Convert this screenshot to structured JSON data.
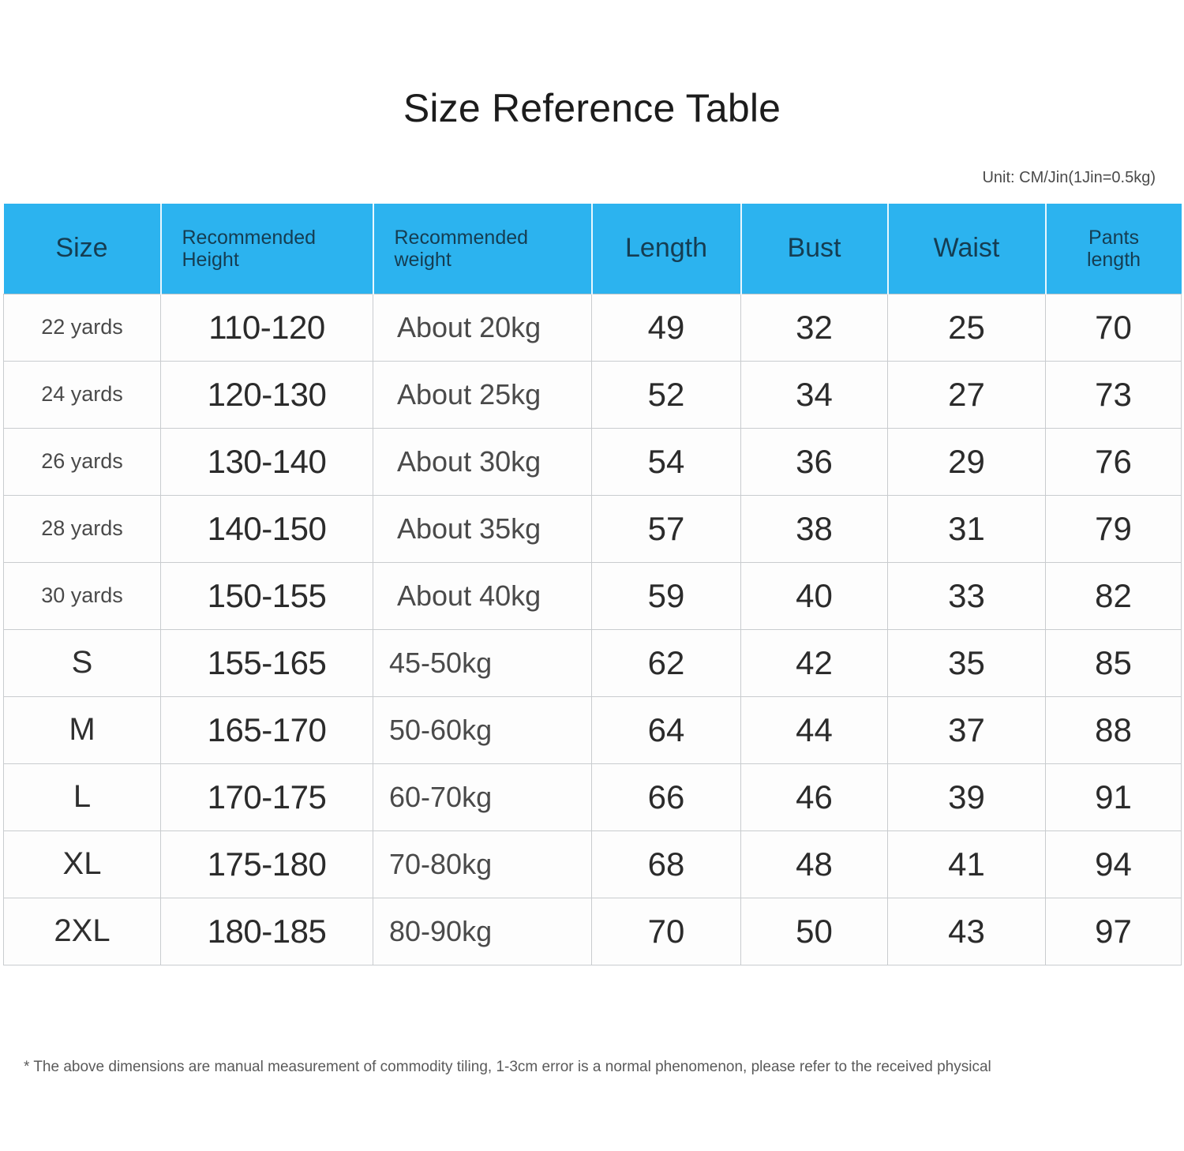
{
  "title": "Size Reference Table",
  "unit_note": "Unit: CM/Jin(1Jin=0.5kg)",
  "colors": {
    "header_bg": "#2cb3ef",
    "header_text": "#153d52",
    "body_text": "#2b2b2b",
    "grid_line": "#c9cccf",
    "page_bg": "#ffffff"
  },
  "footnote": "* The above dimensions are manual measurement of commodity tiling, 1-3cm error is a normal phenomenon, please refer to the received physical",
  "table": {
    "headers": [
      "Size",
      "Recommended Height",
      "Recommended weight",
      "Length",
      "Bust",
      "Waist",
      "Pants length"
    ],
    "header_lines": {
      "height_l1": "Recommended",
      "height_l2": "Height",
      "weight_l1": "Recommended",
      "weight_l2": "weight",
      "pants_l1": "Pants",
      "pants_l2": "length"
    },
    "rows": [
      {
        "size": "22 yards",
        "height": "110-120",
        "weight": "About 20kg",
        "length": "49",
        "bust": "32",
        "waist": "25",
        "pants": "70"
      },
      {
        "size": "24 yards",
        "height": "120-130",
        "weight": "About 25kg",
        "length": "52",
        "bust": "34",
        "waist": "27",
        "pants": "73"
      },
      {
        "size": "26 yards",
        "height": "130-140",
        "weight": "About 30kg",
        "length": "54",
        "bust": "36",
        "waist": "29",
        "pants": "76"
      },
      {
        "size": "28 yards",
        "height": "140-150",
        "weight": "About 35kg",
        "length": "57",
        "bust": "38",
        "waist": "31",
        "pants": "79"
      },
      {
        "size": "30 yards",
        "height": "150-155",
        "weight": "About 40kg",
        "length": "59",
        "bust": "40",
        "waist": "33",
        "pants": "82"
      },
      {
        "size": "S",
        "height": "155-165",
        "weight": "45-50kg",
        "length": "62",
        "bust": "42",
        "waist": "35",
        "pants": "85"
      },
      {
        "size": "M",
        "height": "165-170",
        "weight": "50-60kg",
        "length": "64",
        "bust": "44",
        "waist": "37",
        "pants": "88"
      },
      {
        "size": "L",
        "height": "170-175",
        "weight": "60-70kg",
        "length": "66",
        "bust": "46",
        "waist": "39",
        "pants": "91"
      },
      {
        "size": "XL",
        "height": "175-180",
        "weight": "70-80kg",
        "length": "68",
        "bust": "48",
        "waist": "41",
        "pants": "94"
      },
      {
        "size": "2XL",
        "height": "180-185",
        "weight": "80-90kg",
        "length": "70",
        "bust": "50",
        "waist": "43",
        "pants": "97"
      }
    ]
  }
}
